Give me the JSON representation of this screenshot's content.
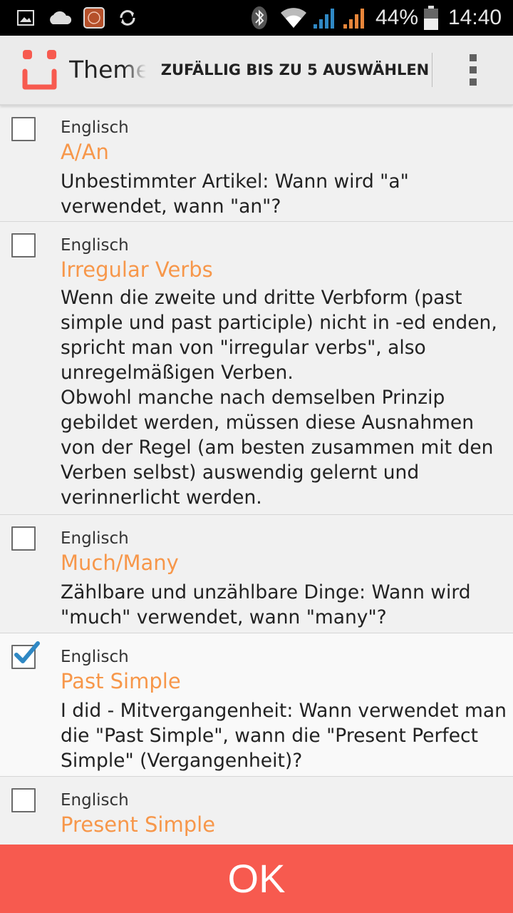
{
  "status_bar": {
    "battery": "44%",
    "time": "14:40",
    "icons": [
      "image-icon",
      "cloud-icon",
      "mi-icon",
      "sync-icon",
      "bluetooth-icon",
      "wifi-icon",
      "signal-icon",
      "signal-icon",
      "battery-icon"
    ]
  },
  "action_bar": {
    "title": "Themen",
    "random_button": "ZUFÄLLIG BIS ZU 5 AUSWÄHLEN",
    "logo_color": "#f75a4f",
    "menu_icon": "overflow-menu-icon"
  },
  "topics": [
    {
      "category": "Englisch",
      "title": "A/An",
      "description": "Unbestimmter Artikel: Wann wird \"a\" verwendet, wann \"an\"?",
      "checked": false
    },
    {
      "category": "Englisch",
      "title": "Irregular Verbs",
      "description": "Wenn die zweite und dritte Verbform (past simple und past participle) nicht in -ed enden, spricht man von \"irregular verbs\", also unregelmäßigen Verben.\nObwohl manche nach demselben Prinzip gebildet werden, müssen diese Ausnahmen von der Regel (am besten zusammen mit den Verben selbst) auswendig gelernt und verinnerlicht werden.",
      "checked": false
    },
    {
      "category": "Englisch",
      "title": "Much/Many",
      "description": "Zählbare und unzählbare Dinge: Wann wird \"much\" verwendet, wann \"many\"?",
      "checked": false
    },
    {
      "category": "Englisch",
      "title": "Past Simple",
      "description": "I did - Mitvergangenheit: Wann verwendet man die \"Past Simple\", wann die \"Present Perfect Simple\" (Vergangenheit)?",
      "checked": true
    },
    {
      "category": "Englisch",
      "title": "Present Simple",
      "description": "",
      "checked": false
    }
  ],
  "ok_button": "OK",
  "colors": {
    "accent": "#f75a4f",
    "title": "#f7974a",
    "check": "#2f88c4"
  }
}
